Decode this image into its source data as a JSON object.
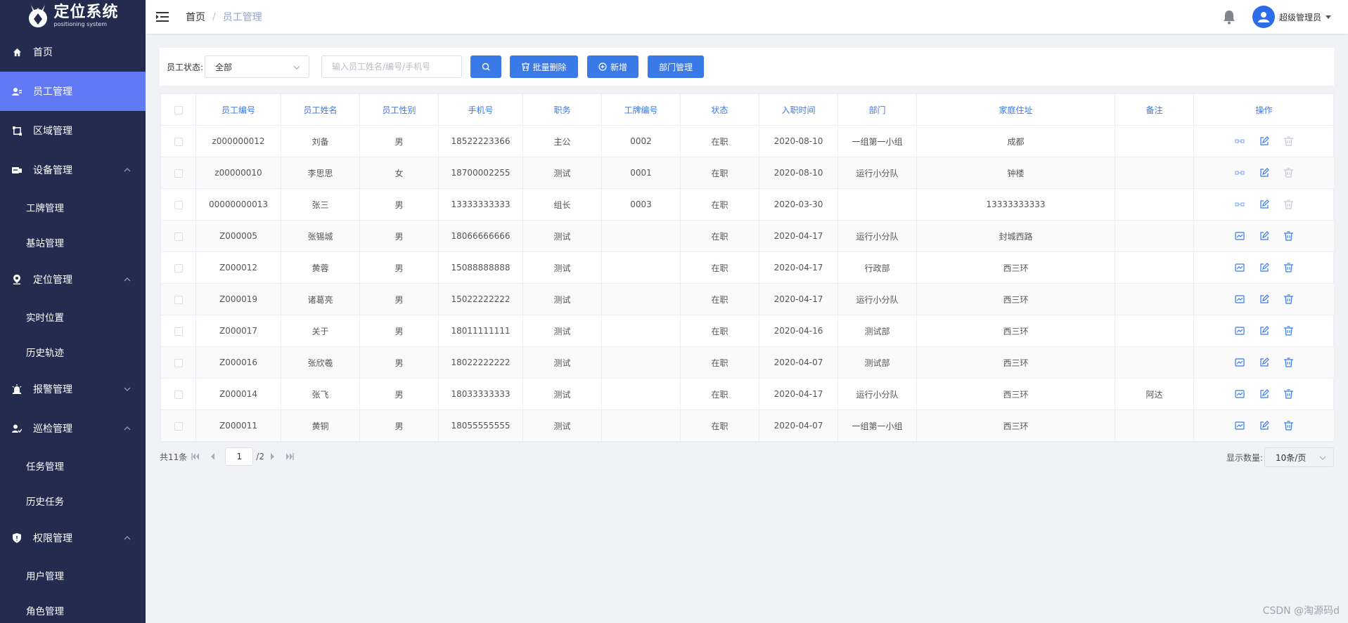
{
  "app": {
    "title": "定位系统",
    "subtitle": "positioning system"
  },
  "sidebar": {
    "items": [
      {
        "label": "首页"
      },
      {
        "label": "员工管理"
      },
      {
        "label": "区域管理"
      },
      {
        "label": "设备管理",
        "children": [
          "工牌管理",
          "基站管理"
        ]
      },
      {
        "label": "定位管理",
        "children": [
          "实时位置",
          "历史轨迹"
        ]
      },
      {
        "label": "报警管理"
      },
      {
        "label": "巡检管理",
        "children": [
          "任务管理",
          "历史任务"
        ]
      },
      {
        "label": "权限管理",
        "children": [
          "用户管理",
          "角色管理"
        ]
      }
    ]
  },
  "header": {
    "breadcrumb": [
      "首页",
      "员工管理"
    ],
    "user": "超级管理员"
  },
  "toolbar": {
    "status_label": "员工状态:",
    "status_value": "全部",
    "search_placeholder": "输入员工姓名/编号/手机号",
    "batch_delete": "批量删除",
    "add": "新增",
    "dept_manage": "部门管理"
  },
  "table": {
    "columns": [
      "员工编号",
      "员工姓名",
      "员工性别",
      "手机号",
      "职务",
      "工牌编号",
      "状态",
      "入职时间",
      "部门",
      "家庭住址",
      "备注",
      "操作"
    ],
    "rows": [
      [
        "z000000012",
        "刘备",
        "男",
        "18522223366",
        "主公",
        "0002",
        "在职",
        "2020-08-10",
        "一组第一小组",
        "成都",
        ""
      ],
      [
        "z00000010",
        "李思思",
        "女",
        "18700002255",
        "测试",
        "0001",
        "在职",
        "2020-08-10",
        "运行小分队",
        "钟楼",
        ""
      ],
      [
        "00000000013",
        "张三",
        "男",
        "13333333333",
        "组长",
        "0003",
        "在职",
        "2020-03-30",
        "",
        "13333333333",
        ""
      ],
      [
        "Z000005",
        "张锡城",
        "男",
        "18066666666",
        "测试",
        "",
        "在职",
        "2020-04-17",
        "运行小分队",
        "封城西路",
        ""
      ],
      [
        "Z000012",
        "黄蓉",
        "男",
        "15088888888",
        "测试",
        "",
        "在职",
        "2020-04-17",
        "行政部",
        "西三环",
        ""
      ],
      [
        "Z000019",
        "诸葛亮",
        "男",
        "15022222222",
        "测试",
        "",
        "在职",
        "2020-04-17",
        "运行小分队",
        "西三环",
        ""
      ],
      [
        "Z000017",
        "关于",
        "男",
        "18011111111",
        "测试",
        "",
        "在职",
        "2020-04-16",
        "测试部",
        "西三环",
        ""
      ],
      [
        "Z000016",
        "张欣羲",
        "男",
        "18022222222",
        "测试",
        "",
        "在职",
        "2020-04-07",
        "测试部",
        "西三环",
        ""
      ],
      [
        "Z000014",
        "张飞",
        "男",
        "18033333333",
        "测试",
        "",
        "在职",
        "2020-04-17",
        "运行小分队",
        "西三环",
        "阿达"
      ],
      [
        "Z000011",
        "黄铜",
        "男",
        "18055555555",
        "测试",
        "",
        "在职",
        "2020-04-07",
        "一组第一小组",
        "西三环",
        ""
      ]
    ]
  },
  "pagination": {
    "total": "共11条",
    "current": "1",
    "pages": "/2",
    "size_label": "显示数量:",
    "size_value": "10条/页"
  },
  "watermark": "CSDN @淘源码d",
  "colors": {
    "sidebar": "#232c4e",
    "active": "#6179f4",
    "primary": "#3a79e8"
  }
}
